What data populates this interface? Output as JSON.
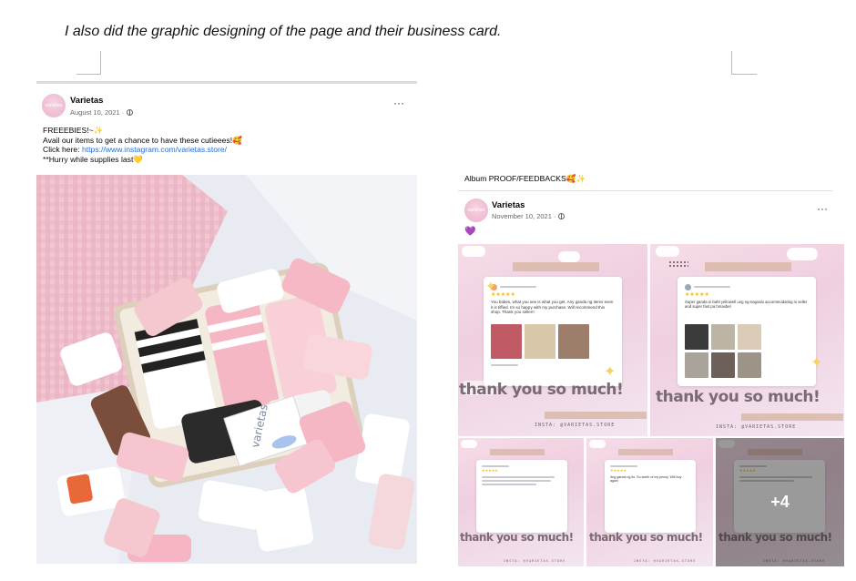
{
  "caption": "I also did the graphic designing of the page and their business card.",
  "post1": {
    "avatar_text": "varietas",
    "page_name": "Varietas",
    "date": "August 10, 2021 ·",
    "more": "···",
    "lines": {
      "l1": "FREEEBIES!~",
      "l1_emoji": "✨",
      "l2": "Avail our items to get a chance to have these cutieees!",
      "l2_emoji": "🥰",
      "l3_prefix": "Click here: ",
      "l3_link": "https://www.instagram.com/varietas.store/",
      "l4": "**Hurry while supplies last",
      "l4_emoji": "💛"
    },
    "photo_card_text": "varietas",
    "photo_description_icon": "socks-flatlay-photo"
  },
  "post2": {
    "album_prefix": "Album ",
    "album_title": "PROOF/FEEDBACKS",
    "album_emojis": "🥰✨",
    "avatar_text": "varietas",
    "page_name": "Varietas",
    "date": "November 10, 2021 ·",
    "more": "···",
    "emoji": "💜",
    "tiles": [
      {
        "thanks": "thank you so much!",
        "insta": "INSTA: @VARIETAS.STORE"
      },
      {
        "thanks": "thank you so much!",
        "insta": "INSTA: @VARIETAS.STORE"
      },
      {
        "thanks": "thank you so much!",
        "insta": "INSTA: @VARIETAS.STORE"
      },
      {
        "thanks": "thank you so much!",
        "insta": "INSTA: @VARIETAS.STORE"
      },
      {
        "thanks": "thank you so much!",
        "insta": "INSTA: @VARIETAS.STORE"
      }
    ],
    "more_count": "+4",
    "review_texts": {
      "t1": "You babes, what you see is what you get. Any ganda ng items even it is tiffied. Im so happy with my purchase. Will recommend this shop. Thank you seller!!",
      "t2": "Super ganda ni baht yellowell ung ng-nagsalo accommodating ni seller and super fast pa hmaxbel",
      "t4": "Ang ganda ng ito. So worth of my penny. Will buy again"
    }
  },
  "colors": {
    "accent_link": "#216fdb",
    "fb_text": "#050505",
    "fb_meta": "#65676b",
    "tile_pink": "#f6dce8",
    "star_yellow": "#f6b81c"
  }
}
